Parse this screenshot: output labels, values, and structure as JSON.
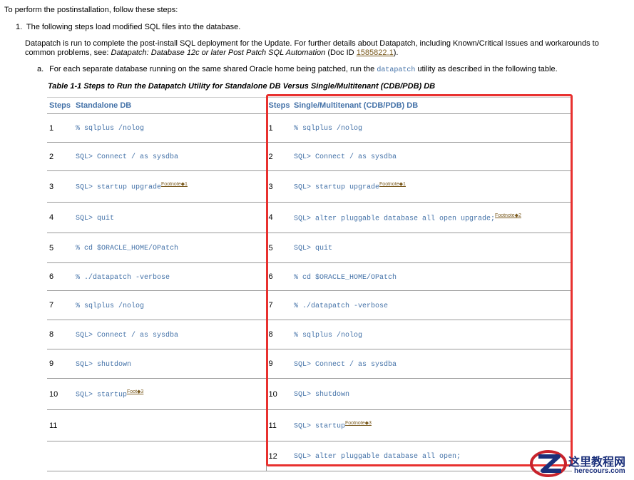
{
  "intro": "To perform the postinstallation, follow these steps:",
  "step1": {
    "num": "1.",
    "text": "The following steps load modified SQL files into the database.",
    "para_a": "Datapatch is run to complete the post-install SQL deployment for the Update. For further details about Datapatch, including Known/Critical Issues and workarounds to common problems, see: ",
    "para_italic": "Datapatch: Database 12c or later Post Patch SQL Automation",
    "para_b": " (Doc ID ",
    "doc_id": "1585822.1",
    "para_c": ")."
  },
  "suba": {
    "label": "a.",
    "text_a": "For each separate database running on the same shared Oracle home being patched, run the ",
    "code": "datapatch",
    "text_b": " utility as described in the following table."
  },
  "table": {
    "caption": "Table 1-1 Steps to Run the Datapatch Utility for Standalone DB Versus Single/Multitenant (CDB/PDB) DB",
    "headers": [
      "Steps",
      "Standalone DB",
      "Steps",
      "Single/Multitenant (CDB/PDB) DB"
    ],
    "rows": [
      {
        "s1": "1",
        "c1": "% sqlplus /nolog",
        "f1": "",
        "s2": "1",
        "c2": "% sqlplus /nolog",
        "f2": ""
      },
      {
        "s1": "2",
        "c1": "SQL> Connect / as sysdba",
        "f1": "",
        "s2": "2",
        "c2": "SQL> Connect / as sysdba",
        "f2": ""
      },
      {
        "s1": "3",
        "c1": "SQL> startup upgrade",
        "f1": "Footnote◆1",
        "s2": "3",
        "c2": "SQL> startup upgrade",
        "f2": "Footnote◆1"
      },
      {
        "s1": "4",
        "c1": "SQL> quit",
        "f1": "",
        "s2": "4",
        "c2": "SQL> alter pluggable database all open upgrade;",
        "f2": "Footnote◆2"
      },
      {
        "s1": "5",
        "c1": "% cd $ORACLE_HOME/OPatch",
        "f1": "",
        "s2": "5",
        "c2": "SQL> quit",
        "f2": ""
      },
      {
        "s1": "6",
        "c1": "% ./datapatch -verbose",
        "f1": "",
        "s2": "6",
        "c2": "% cd $ORACLE_HOME/OPatch",
        "f2": ""
      },
      {
        "s1": "7",
        "c1": "% sqlplus /nolog",
        "f1": "",
        "s2": "7",
        "c2": "% ./datapatch -verbose",
        "f2": ""
      },
      {
        "s1": "8",
        "c1": "SQL> Connect / as sysdba",
        "f1": "",
        "s2": "8",
        "c2": "% sqlplus /nolog",
        "f2": ""
      },
      {
        "s1": "9",
        "c1": "SQL> shutdown",
        "f1": "",
        "s2": "9",
        "c2": "SQL> Connect / as sysdba",
        "f2": ""
      },
      {
        "s1": "10",
        "c1": "SQL> startup",
        "f1": "Foot◆3",
        "s2": "10",
        "c2": "SQL> shutdown",
        "f2": ""
      },
      {
        "s1": "11",
        "c1": "",
        "f1": "",
        "s2": "11",
        "c2": "SQL> startup",
        "f2": "Footnote◆3"
      },
      {
        "s1": "",
        "c1": "",
        "f1": "",
        "s2": "12",
        "c2": "SQL> alter pluggable database all open;",
        "f2": ""
      }
    ]
  },
  "watermark": {
    "line1": "这里教程网",
    "line2": "herecours.com"
  },
  "colors": {
    "accent": "#4472a8",
    "highlight": "#e8312f",
    "link": "#7a5a1e"
  }
}
